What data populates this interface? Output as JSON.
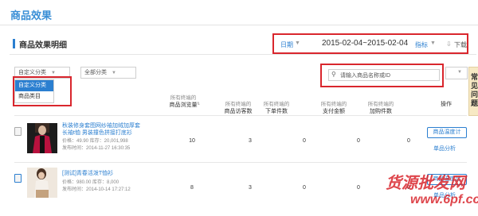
{
  "page": {
    "title": "商品效果"
  },
  "section": {
    "title": "商品效果明细"
  },
  "filters": {
    "date_label": "日期",
    "date_range": "2015-02-04~2015-02-04",
    "metric_label": "指标",
    "download_label": "下载",
    "custom_category": "自定义分类",
    "all_categories": "全部分类",
    "dropdown_options": [
      "自定义分类",
      "商品类目"
    ],
    "search_placeholder": "请输入商品名称或ID"
  },
  "popup": {
    "text": "常见问题"
  },
  "table": {
    "headers": [
      {
        "sub": "所有终端的",
        "label": "商品浏览量"
      },
      {
        "sub": "所有终端的",
        "label": "商品访客数"
      },
      {
        "sub": "所有终端的",
        "label": "下单件数"
      },
      {
        "sub": "所有终端的",
        "label": "支付金额"
      },
      {
        "sub": "所有终端的",
        "label": "加购件数"
      },
      {
        "sub": "",
        "label": "操作"
      }
    ],
    "rows": [
      {
        "title_line1": "秋装修身套图网纱袖加绒加厚套",
        "title_line2": "长袖t恤 男装撞色拼接打底衫",
        "meta1": "价格：49.90   库存：20,001,998",
        "meta2": "发布时间：2014-11-27 16:30:35",
        "values": [
          "10",
          "3",
          "0",
          "0",
          "0"
        ],
        "action_button": "商品温度计",
        "action_link": "单品分析"
      },
      {
        "title_line1": "[测试]青春活泼T恤衫",
        "title_line2": "",
        "meta1": "价格：980.00   库存：8,000",
        "meta2": "发布时间：2014-10-14 17:27:12",
        "values": [
          "8",
          "3",
          "0",
          "0",
          "0"
        ],
        "action_button": "商品温度计",
        "action_link": "单品分析"
      }
    ]
  },
  "watermark": {
    "line1": "货源批发网",
    "line2": "www.6pf.cc"
  }
}
